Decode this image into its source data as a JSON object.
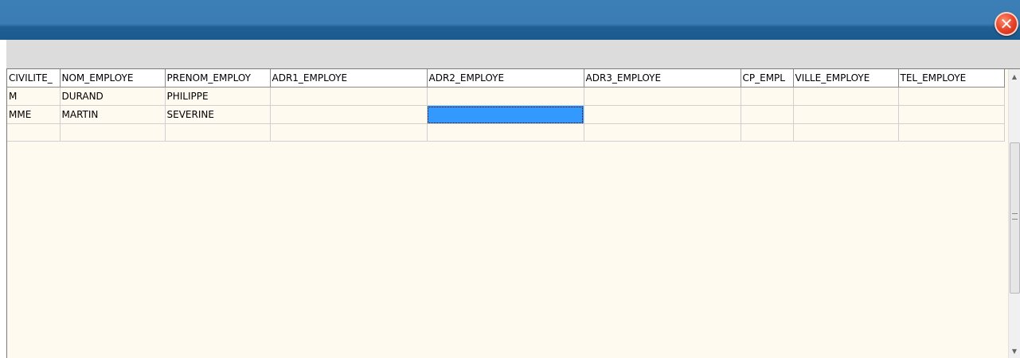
{
  "window": {
    "title": "",
    "close_icon": "close-icon",
    "close_glyph": "✕",
    "accent": "#1b5a8e",
    "close_color": "#e8442a"
  },
  "grid": {
    "columns": [
      "CIVILITE_",
      "NOM_EMPLOYE",
      "PRENOM_EMPLOY",
      "ADR1_EMPLOYE",
      "ADR2_EMPLOYE",
      "ADR3_EMPLOYE",
      "CP_EMPL",
      "VILLE_EMPLOYE",
      "TEL_EMPLOYE"
    ],
    "rows": [
      [
        "M",
        "DURAND",
        "PHILIPPE",
        "",
        "",
        "",
        "",
        "",
        ""
      ],
      [
        "MME",
        "MARTIN",
        "SEVERINE",
        "",
        "",
        "",
        "",
        "",
        ""
      ],
      [
        "",
        "",
        "",
        "",
        "",
        "",
        "",
        "",
        ""
      ]
    ],
    "selected_cell": {
      "row": 1,
      "column": "ADR2_EMPLOYE"
    },
    "selection_color": "#3399ff",
    "background_color": "#fffaf0"
  },
  "scrollbar": {
    "up_glyph": "▲",
    "down_glyph": "▼"
  }
}
